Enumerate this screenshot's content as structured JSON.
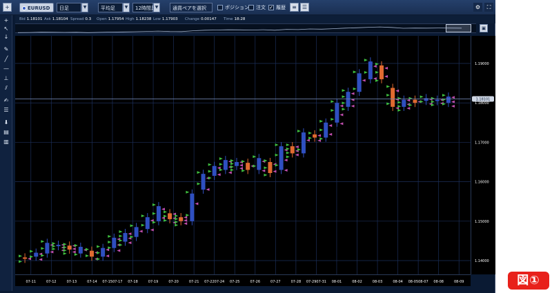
{
  "toolbar": {
    "symbol": "EURUSD",
    "timeframe": "日足",
    "mode": "平均足",
    "period": "12時間足",
    "pair_select_button": "通貨ペアを選択",
    "position_label": "ポジション",
    "order_label": "注文",
    "history_label": "履歴"
  },
  "info": {
    "bid_label": "Bid",
    "bid": "1.18101",
    "ask_label": "Ask",
    "ask": "1.18104",
    "spread_label": "Spread",
    "spread": "0.3",
    "open_label": "Open",
    "open": "1.17954",
    "high_label": "High",
    "high": "1.18238",
    "low_label": "Low",
    "low": "1.17903",
    "change_label": "Change",
    "change": "0.00147",
    "time_label": "Time",
    "time": "18:28"
  },
  "icons": {
    "tools": [
      "add-icon",
      "cursor-icon",
      "crosshair-icon",
      "pen-icon",
      "trendline-icon",
      "hline-icon",
      "anchor-icon",
      "channel-icon",
      "text-icon",
      "list-icon",
      "download-icon",
      "table-icon",
      "trash-icon"
    ],
    "toolbar": [
      "menu-icon",
      "flag-icon",
      "chart-icon",
      "window-icon",
      "gear-icon",
      "expand-icon"
    ]
  },
  "colors": {
    "background": "#000000",
    "frame": "#0a1a33",
    "bull": "#2f4fc0",
    "bear": "#e06a30",
    "marker_green": "#3fbf3f",
    "marker_pink": "#c24fb0",
    "grid": "#1c2f5a",
    "price_line": "#6c7fa8",
    "badge": "#e8211b"
  },
  "chart_data": {
    "type": "candlestick",
    "y_ticks": [
      "1.19000",
      "1.18000",
      "1.17000",
      "1.16000",
      "1.15000",
      "1.14000"
    ],
    "x_ticks": [
      "07-11",
      "07-12",
      "07-13",
      "07-14",
      "07-1507-17",
      "07-18",
      "07-19",
      "07-20",
      "07-21",
      "07-2207-24",
      "07-25",
      "07-26",
      "07-27",
      "07-28",
      "07-2907-31",
      "08-01",
      "08-02",
      "08-03",
      "08-04",
      "08-0508-07",
      "08-08",
      "08-09"
    ],
    "ylim": [
      1.1365,
      1.197
    ],
    "current_price": "1.18101",
    "grid": true,
    "candles": [
      {
        "o": 1.1408,
        "c": 1.1405,
        "dir": "bear"
      },
      {
        "o": 1.141,
        "c": 1.142,
        "dir": "bull"
      },
      {
        "o": 1.1418,
        "c": 1.1445,
        "dir": "bull"
      },
      {
        "o": 1.144,
        "c": 1.144,
        "dir": "bull"
      },
      {
        "o": 1.1438,
        "c": 1.1428,
        "dir": "bear"
      },
      {
        "o": 1.1418,
        "c": 1.1435,
        "dir": "bull"
      },
      {
        "o": 1.1425,
        "c": 1.141,
        "dir": "bear"
      },
      {
        "o": 1.141,
        "c": 1.1432,
        "dir": "bull"
      },
      {
        "o": 1.1432,
        "c": 1.1458,
        "dir": "bull"
      },
      {
        "o": 1.1448,
        "c": 1.147,
        "dir": "bull"
      },
      {
        "o": 1.146,
        "c": 1.1485,
        "dir": "bull"
      },
      {
        "o": 1.148,
        "c": 1.151,
        "dir": "bull"
      },
      {
        "o": 1.15,
        "c": 1.1538,
        "dir": "bull"
      },
      {
        "o": 1.152,
        "c": 1.1505,
        "dir": "bear"
      },
      {
        "o": 1.151,
        "c": 1.15,
        "dir": "bear"
      },
      {
        "o": 1.15,
        "c": 1.157,
        "dir": "bull"
      },
      {
        "o": 1.158,
        "c": 1.162,
        "dir": "bull"
      },
      {
        "o": 1.1615,
        "c": 1.164,
        "dir": "bull"
      },
      {
        "o": 1.163,
        "c": 1.1655,
        "dir": "bull"
      },
      {
        "o": 1.164,
        "c": 1.165,
        "dir": "bull"
      },
      {
        "o": 1.1648,
        "c": 1.163,
        "dir": "bear"
      },
      {
        "o": 1.163,
        "c": 1.166,
        "dir": "bull"
      },
      {
        "o": 1.165,
        "c": 1.1622,
        "dir": "bear"
      },
      {
        "o": 1.163,
        "c": 1.169,
        "dir": "bull"
      },
      {
        "o": 1.169,
        "c": 1.1672,
        "dir": "bear"
      },
      {
        "o": 1.1672,
        "c": 1.1725,
        "dir": "bull"
      },
      {
        "o": 1.172,
        "c": 1.1712,
        "dir": "bear"
      },
      {
        "o": 1.1712,
        "c": 1.175,
        "dir": "bull"
      },
      {
        "o": 1.175,
        "c": 1.18,
        "dir": "bull"
      },
      {
        "o": 1.179,
        "c": 1.1828,
        "dir": "bull"
      },
      {
        "o": 1.1828,
        "c": 1.1875,
        "dir": "bull"
      },
      {
        "o": 1.186,
        "c": 1.1905,
        "dir": "bull"
      },
      {
        "o": 1.1895,
        "c": 1.186,
        "dir": "bear"
      },
      {
        "o": 1.1838,
        "c": 1.179,
        "dir": "bear"
      },
      {
        "o": 1.179,
        "c": 1.1808,
        "dir": "bull"
      },
      {
        "o": 1.1808,
        "c": 1.18,
        "dir": "bear"
      },
      {
        "o": 1.1805,
        "c": 1.1812,
        "dir": "bull"
      },
      {
        "o": 1.1808,
        "c": 1.1808,
        "dir": "bull"
      },
      {
        "o": 1.1816,
        "c": 1.18,
        "dir": "bull"
      }
    ]
  }
}
